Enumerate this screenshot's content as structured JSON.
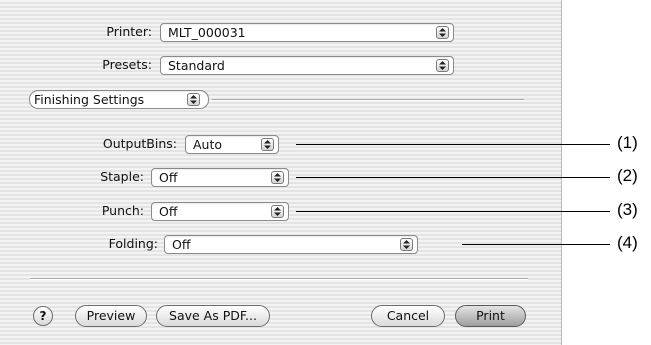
{
  "printer": {
    "label": "Printer:",
    "value": "MLT_000031"
  },
  "presets": {
    "label": "Presets:",
    "value": "Standard"
  },
  "panel_selector": {
    "value": "Finishing Settings"
  },
  "output_bins": {
    "label": "OutputBins:",
    "value": "Auto"
  },
  "staple": {
    "label": "Staple:",
    "value": "Off"
  },
  "punch": {
    "label": "Punch:",
    "value": "Off"
  },
  "folding": {
    "label": "Folding:",
    "value": "Off"
  },
  "buttons": {
    "help": "?",
    "preview": "Preview",
    "save_pdf": "Save As PDF...",
    "cancel": "Cancel",
    "print": "Print"
  },
  "callouts": [
    "(1)",
    "(2)",
    "(3)",
    "(4)"
  ]
}
